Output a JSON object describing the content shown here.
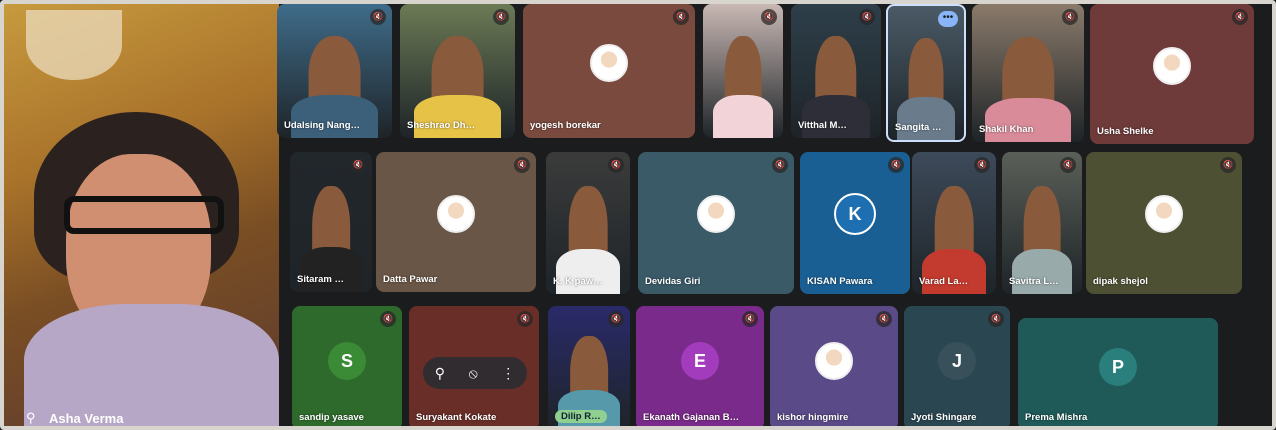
{
  "self_view": {
    "name": "Asha Verma",
    "pin_icon": "pin-icon"
  },
  "participants": [
    {
      "id": "udalsing",
      "name": "Udalsing Nang…",
      "kind": "camera",
      "bg": "#3f6c8a"
    },
    {
      "id": "sheshrao",
      "name": "Sheshrao Dh…",
      "kind": "camera",
      "bg": "#6b7a55"
    },
    {
      "id": "yogesh",
      "name": "yogesh borekar",
      "kind": "photo",
      "bg": "#7a4a3e"
    },
    {
      "id": "p4",
      "name": "",
      "kind": "camera",
      "bg": "#c9b8b4"
    },
    {
      "id": "vitthal",
      "name": "Vitthal M…",
      "kind": "camera",
      "bg": "#2e3f4a"
    },
    {
      "id": "sangita",
      "name": "Sangita …",
      "kind": "camera",
      "bg": "#4a5a66"
    },
    {
      "id": "shakil",
      "name": "Shakil Khan",
      "kind": "camera",
      "bg": "#8a7a6a"
    },
    {
      "id": "usha",
      "name": "Usha Shelke",
      "kind": "photo",
      "bg": "#6e3a3a"
    },
    {
      "id": "sitaram",
      "name": "Sitaram …",
      "kind": "camera",
      "bg": "#22272c"
    },
    {
      "id": "datta",
      "name": "Datta Pawar",
      "kind": "photo",
      "bg": "#6a5646"
    },
    {
      "id": "kirti",
      "name": "K. K paw…",
      "kind": "camera",
      "bg": "#3b3b3b"
    },
    {
      "id": "devidas",
      "name": "Devidas Giri",
      "kind": "photo",
      "bg": "#3a5a68"
    },
    {
      "id": "kisan",
      "name": "KISAN Pawara",
      "kind": "letter",
      "letter": "K",
      "bg": "#1a5f93",
      "avatar_bg": "#1d6fb1"
    },
    {
      "id": "varad",
      "name": "Varad La…",
      "kind": "camera",
      "bg": "#3d4a5a"
    },
    {
      "id": "savitra",
      "name": "Savitra L…",
      "kind": "camera",
      "bg": "#5a5f58"
    },
    {
      "id": "dipak",
      "name": "dipak shejol",
      "kind": "photo",
      "bg": "#4e5034"
    },
    {
      "id": "sandip",
      "name": "sandip yasave",
      "kind": "letter",
      "letter": "S",
      "bg": "#2e6a2c",
      "avatar_bg": "#3a8a36"
    },
    {
      "id": "suryakant",
      "name": "Suryakant Kokate",
      "kind": "blank",
      "bg": "#6a2e28"
    },
    {
      "id": "dilip",
      "name": "Dilip R…",
      "kind": "camera",
      "bg": "#2a2a6a"
    },
    {
      "id": "ekanath",
      "name": "Ekanath Gajanan B…",
      "kind": "letter",
      "letter": "E",
      "bg": "#7a2a8a",
      "avatar_bg": "#a33bbd"
    },
    {
      "id": "kishor",
      "name": "kishor hingmire",
      "kind": "photo",
      "bg": "#5a4a88"
    },
    {
      "id": "jyoti",
      "name": "Jyoti Shingare",
      "kind": "letter",
      "letter": "J",
      "bg": "#2a4650",
      "avatar_bg": "#38505a"
    },
    {
      "id": "prema",
      "name": "Prema Mishra",
      "kind": "letter",
      "letter": "P",
      "bg": "#1f5a58",
      "avatar_bg": "#2a7f7c"
    }
  ],
  "tile_controls": {
    "pin": "pin-icon",
    "unpin": "remove-pin-icon",
    "more": "more-options-icon"
  },
  "more_icon_glyph": "⋮"
}
